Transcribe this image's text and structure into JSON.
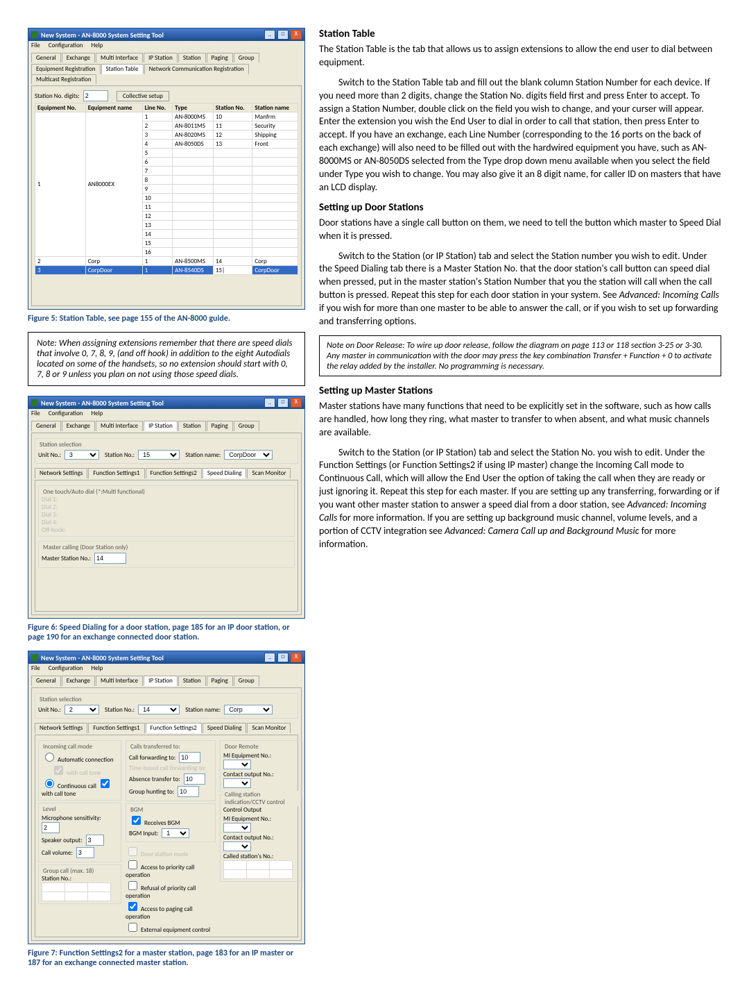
{
  "window1": {
    "title": "New System - AN-8000 System Setting Tool",
    "menu": [
      "File",
      "Configuration",
      "Help"
    ],
    "tabs_top": [
      "General",
      "Exchange",
      "Multi Interface",
      "IP Station",
      "Station",
      "Paging",
      "Group"
    ],
    "tabs_sub": [
      "Equipment Registration",
      "Station Table",
      "Network Communication Registration",
      "Multicast Registration"
    ],
    "active_sub": "Station Table",
    "station_no_digits_label": "Station No. digits:",
    "station_no_digits_val": "2",
    "collective_setup": "Collective setup",
    "headers": [
      "Equipment No.",
      "Equipment name",
      "Line No.",
      "Type",
      "Station No.",
      "Station name"
    ],
    "rows": [
      {
        "no": "1",
        "name": "AN8000EX",
        "lines": [
          {
            "ln": "1",
            "type": "AN-8000MS",
            "sn": "10",
            "sname": "Manfrm"
          },
          {
            "ln": "2",
            "type": "AN-8011MS",
            "sn": "11",
            "sname": "Security"
          },
          {
            "ln": "3",
            "type": "AN-8020MS",
            "sn": "12",
            "sname": "Shipping"
          },
          {
            "ln": "4",
            "type": "AN-8050DS",
            "sn": "13",
            "sname": "Front"
          },
          {
            "ln": "5"
          },
          {
            "ln": "6"
          },
          {
            "ln": "7"
          },
          {
            "ln": "8"
          },
          {
            "ln": "9"
          },
          {
            "ln": "10"
          },
          {
            "ln": "11"
          },
          {
            "ln": "12"
          },
          {
            "ln": "13"
          },
          {
            "ln": "14"
          },
          {
            "ln": "15"
          },
          {
            "ln": "16"
          }
        ]
      },
      {
        "no": "2",
        "name": "Corp",
        "lines": [
          {
            "ln": "1",
            "type": "AN-8500MS",
            "sn": "14",
            "sname": "Corp"
          }
        ]
      },
      {
        "no": "3",
        "name": "CorpDoor",
        "lines": [
          {
            "ln": "1",
            "type": "AN-8540DS",
            "sn": "15",
            "sname": "CorpDoor",
            "editing": true
          }
        ]
      }
    ]
  },
  "caption1": "Figure 5: Station Table, see page 155 of the AN-8000 guide.",
  "note1": "Note: When assigning extensions remember that there are speed dials that involve 0, 7, 8, 9, (and off hook) in addition to the eight Autodials located on some of the handsets, so no extension should start with 0, 7, 8 or 9 unless you plan on not using those speed dials.",
  "window2": {
    "title": "New System - AN-8000 System Setting Tool",
    "menu": [
      "File",
      "Configuration",
      "Help"
    ],
    "tabs_top": [
      "General",
      "Exchange",
      "Multi Interface",
      "IP Station",
      "Station",
      "Paging",
      "Group"
    ],
    "station_sel_label": "Station selection",
    "unit_label": "Unit No.:",
    "unit_val": "3",
    "station_no_label": "Station No.:",
    "station_no_val": "15",
    "station_name_label": "Station name:",
    "station_name_val": "CorpDoor",
    "tabs_sub": [
      "Network Settings",
      "Function Settings1",
      "Function Settings2",
      "Speed Dialing",
      "Scan Monitor"
    ],
    "active_sub": "Speed Dialing",
    "onetouch_label": "One touch/Auto dial (*:Multi functional)",
    "dials": [
      "Dial 1:",
      "Dial 2:",
      "Dial 3:",
      "Dial 4:",
      "Off-hook:"
    ],
    "master_label": "Master calling (Door Station only)",
    "master_no_label": "Master Station No.:",
    "master_no_val": "14"
  },
  "caption2": "Figure 6: Speed Dialing for a door station, page 185 for an IP door station, or page 190 for an exchange connected door station.",
  "window3": {
    "title": "New System - AN-8000 System Setting Tool",
    "menu": [
      "File",
      "Configuration",
      "Help"
    ],
    "tabs_top": [
      "General",
      "Exchange",
      "Multi Interface",
      "IP Station",
      "Station",
      "Paging",
      "Group"
    ],
    "station_sel_label": "Station selection",
    "unit_label": "Unit No.:",
    "unit_val": "2",
    "station_no_label": "Station No.:",
    "station_no_val": "14",
    "station_name_label": "Station name:",
    "station_name_val": "Corp",
    "tabs_sub": [
      "Network Settings",
      "Function Settings1",
      "Function Settings2",
      "Speed Dialing",
      "Scan Monitor"
    ],
    "active_sub": "Function Settings2",
    "incoming_label": "Incoming call mode",
    "auto_conn": "Automatic connection",
    "with_call_tone": "with call tone",
    "continuous": "Continuous call",
    "with_call_tone2": "with call tone",
    "level_label": "Level",
    "mic_label": "Microphone sensitivity:",
    "mic_val": "2",
    "spk_label": "Speaker output:",
    "spk_val": "3",
    "vol_label": "Call volume:",
    "vol_val": "3",
    "group_call_label": "Group call (max. 18)",
    "station_no_col": "Station No.:",
    "calls_trans_label": "Calls transferred to:",
    "call_fwd_label": "Call forwarding to:",
    "call_fwd_val": "10",
    "time_based_label": "Time-based call forwarding to:",
    "absence_label": "Absence transfer to:",
    "absence_val": "10",
    "group_hunt_label": "Group hunting to:",
    "group_hunt_val": "10",
    "bgm_label": "BGM",
    "receives_bgm": "Receives BGM",
    "bgm_input_label": "BGM Input:",
    "bgm_input_val": "1",
    "door_station_mode": "Door station mode",
    "access_priority": "Access to priority call operation",
    "refusal_priority": "Refusal of priority call operation",
    "access_paging": "Access to paging call operation",
    "external_ctrl": "External equipment control",
    "door_remote_label": "Door Remote",
    "mi_equip_label": "MI Equipment No.:",
    "contact_out_label": "Contact output No.:",
    "calling_cctv_label": "Calling station indication/CCTV control",
    "control_out_label": "Control Output",
    "called_station_label": "Called station's No.:"
  },
  "caption3": "Figure 7: Function Settings2 for a master station, page 183 for an IP master or 187 for an exchange connected master station.",
  "right": {
    "h1": "Station Table",
    "p1a": "The Station Table is the tab that allows us to assign extensions to allow the end user to dial between equipment.",
    "p1b": "Switch to the Station Table tab and fill out the blank column Station Number for each device.  If you need more than 2 digits, change the Station No. digits field first and press Enter to accept.  To assign a Station Number, double click on the field you wish to change, and your curser will appear.  Enter the extension you wish the End User to dial in order to call that station, then press Enter to accept.  If you have an exchange, each Line Number (corresponding to the 16 ports on the back of each exchange) will also need to be filled out with the hardwired equipment you have, such as AN-8000MS or AN-8050DS selected from the Type drop down menu available when you select the field under Type you wish to change.  You may also give it an 8 digit name, for caller ID on masters that have an LCD display.",
    "h2": "Setting up Door Stations",
    "p2a": "Door stations have a single call button on them, we need to tell the button which master to Speed Dial when it is pressed.",
    "p2b_pre": "Switch to the Station (or IP Station) tab and select the Station number you wish to edit.  Under the Speed Dialing tab there is a Master Station No. that the door station's call button can speed dial when pressed, put in the master station's Station Number that you the station will call when the call button is pressed.  Repeat this step for each door station in your system.  See ",
    "p2b_em": "Advanced: Incoming Calls",
    "p2b_post": " if you wish for more than one master to be able to answer the call, or if you wish to set up forwarding and transferring options.",
    "note2_lead": "Note on Door Release",
    "note2_body": ":  To wire up door release, follow the diagram on page 113 or 118 section 3-25 or 3-30.  Any master in communication with the door may press the key combination Transfer + Function + 0 to activate the relay added by the installer.  No programming is necessary.",
    "h3": "Setting up Master Stations",
    "p3a": "Master stations have many functions that need to be explicitly set in the software, such as how calls are handled, how long they ring, what master to transfer to when absent, and what music channels are available.",
    "p3b_1": "Switch to the Station (or IP Station) tab and select the Station No. you wish to edit.  Under the Function Settings (or Function Settings2 if using IP master) change the Incoming Call mode to Continuous Call, which will allow the End User the option of taking the call when they are ready or just ignoring it.  Repeat this step for each master.  If you are setting up any transferring, forwarding or if you want other master station to answer a speed dial from a door station, see ",
    "p3b_em1": "Advanced: Incoming Calls",
    "p3b_2": " for more information.  If you are setting up background music channel, volume levels, and a portion of CCTV integration see ",
    "p3b_em2": "Advanced: Camera Call up and Background Music",
    "p3b_3": " for more information."
  }
}
